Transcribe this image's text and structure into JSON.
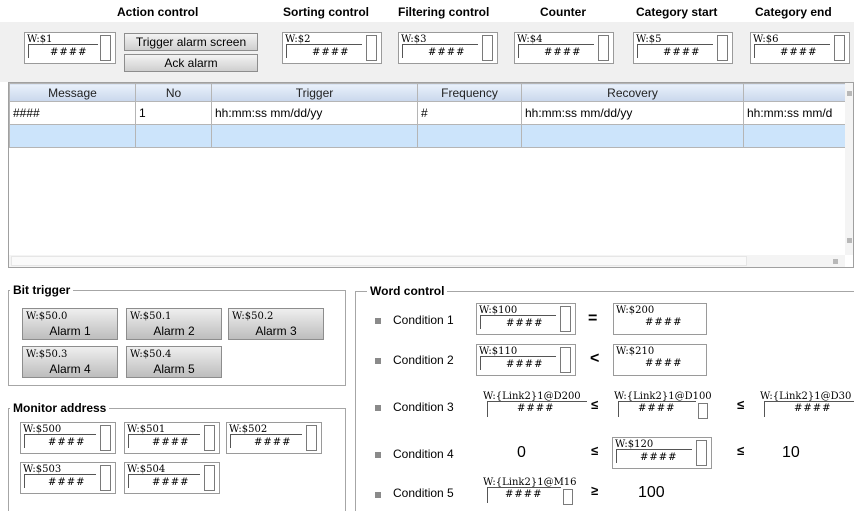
{
  "headers": {
    "action": "Action control",
    "sorting": "Sorting control",
    "filtering": "Filtering control",
    "counter": "Counter",
    "cat_start": "Category start",
    "cat_end": "Category end"
  },
  "top_tags": [
    "W:$1",
    "W:$2",
    "W:$3",
    "W:$4",
    "W:$5",
    "W:$6"
  ],
  "hash": "####",
  "buttons": {
    "trigger_alarm": "Trigger alarm screen",
    "ack_alarm": "Ack alarm"
  },
  "table": {
    "columns": [
      "Message",
      "No",
      "Trigger",
      "Frequency",
      "Recovery",
      ""
    ],
    "rows": [
      [
        "####",
        "1",
        "hh:mm:ss mm/dd/yy",
        "#",
        "hh:mm:ss mm/dd/yy",
        "hh:mm:ss mm/d"
      ],
      [
        "",
        "",
        "",
        "",
        "",
        ""
      ]
    ]
  },
  "bit_trigger": {
    "title": "Bit trigger",
    "buttons": [
      {
        "tag": "W:$50.0",
        "label": "Alarm 1"
      },
      {
        "tag": "W:$50.1",
        "label": "Alarm 2"
      },
      {
        "tag": "W:$50.2",
        "label": "Alarm 3"
      },
      {
        "tag": "W:$50.3",
        "label": "Alarm 4"
      },
      {
        "tag": "W:$50.4",
        "label": "Alarm 5"
      }
    ]
  },
  "monitor": {
    "title": "Monitor address",
    "tags": [
      "W:$500",
      "W:$501",
      "W:$502",
      "W:$503",
      "W:$504"
    ]
  },
  "word_control": {
    "title": "Word control",
    "conditions": [
      {
        "label": "Condition 1",
        "left": "W:$100",
        "op": "=",
        "right": "W:$200"
      },
      {
        "label": "Condition 2",
        "left": "W:$110",
        "op": "<",
        "right": "W:$210"
      },
      {
        "label": "Condition 3",
        "left": "W:{Link2}1@D200",
        "op": "≤",
        "mid": "W:{Link2}1@D100",
        "op2": "≤",
        "right": "W:{Link2}1@D30"
      },
      {
        "label": "Condition 4",
        "left": "0",
        "op": "≤",
        "mid": "W:$120",
        "op2": "≤",
        "right": "10"
      },
      {
        "label": "Condition 5",
        "left": "W:{Link2}1@M16",
        "op": "≥",
        "right": "100"
      }
    ]
  }
}
